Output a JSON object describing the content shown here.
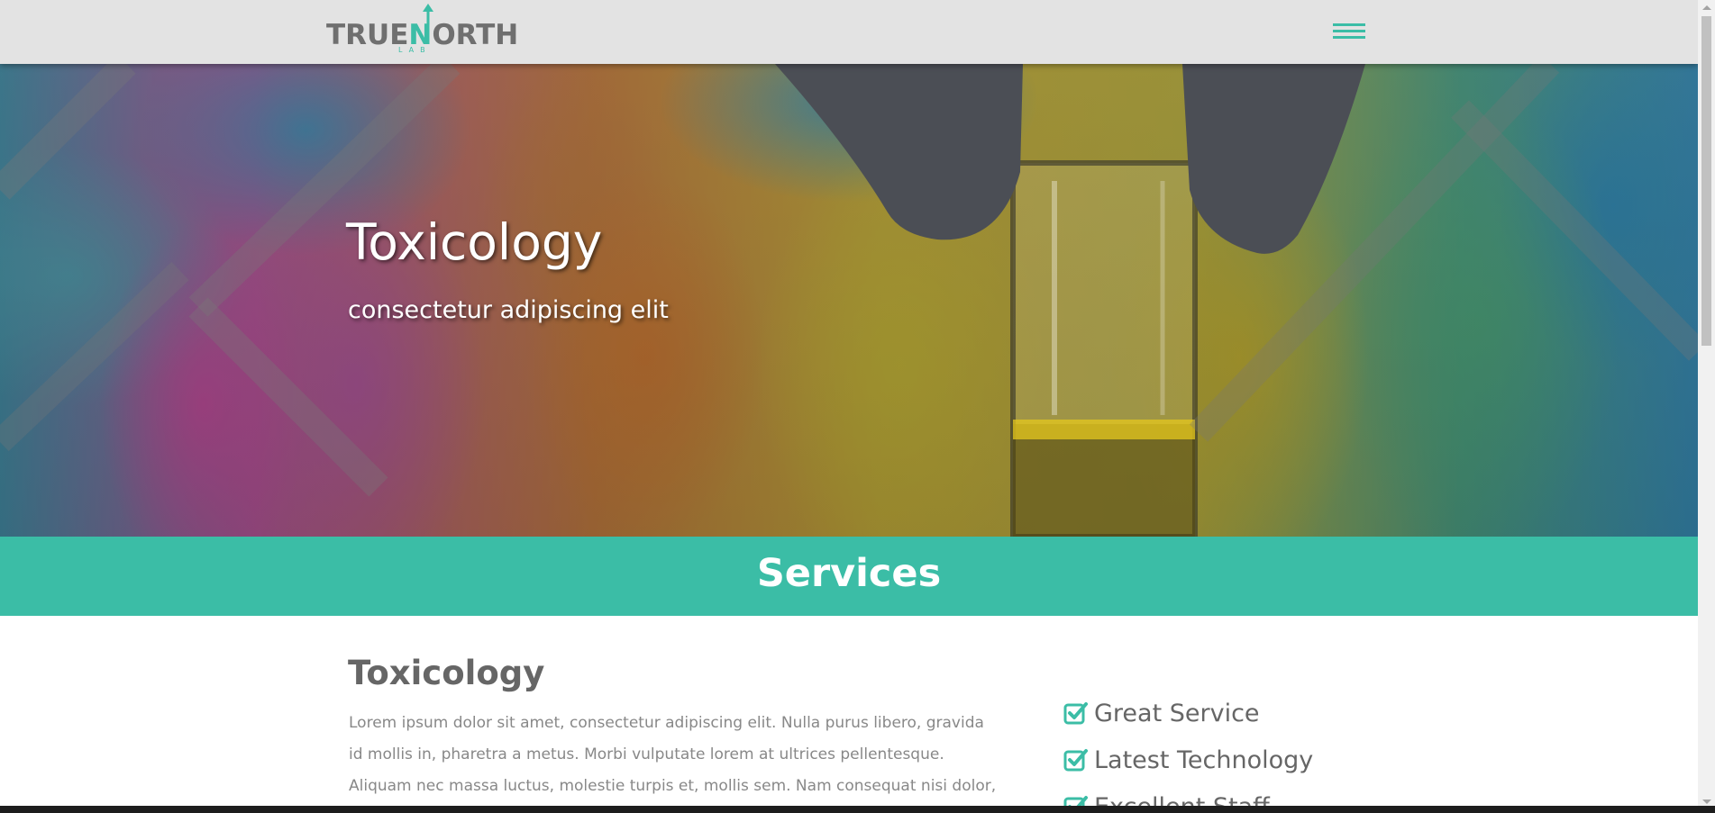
{
  "header": {
    "logo": {
      "word_part1": "TRUE",
      "word_n": "N",
      "word_part2": "ORTH",
      "sub": "LAB"
    },
    "menu_icon": "hamburger-menu-icon"
  },
  "hero": {
    "title": "Toxicology",
    "subtitle": "consectetur adipiscing elit"
  },
  "services": {
    "title": "Services"
  },
  "content": {
    "title": "Toxicology",
    "body": "Lorem ipsum dolor sit amet, consectetur adipiscing elit. Nulla purus libero, gravida id mollis in, pharetra a metus. Morbi vulputate lorem at ultrices pellentesque. Aliquam nec massa luctus, molestie turpis et, mollis sem. Nam consequat nisi dolor, vitae",
    "features": [
      {
        "label": "Great Service",
        "icon": "check-square-icon"
      },
      {
        "label": "Latest Technology",
        "icon": "check-square-icon"
      },
      {
        "label": "Excellent Staff",
        "icon": "check-square-icon"
      }
    ]
  },
  "colors": {
    "accent": "#3bbda6",
    "header_bg": "#e3e3e3",
    "text_dark": "#666666",
    "text_muted": "#888888"
  }
}
